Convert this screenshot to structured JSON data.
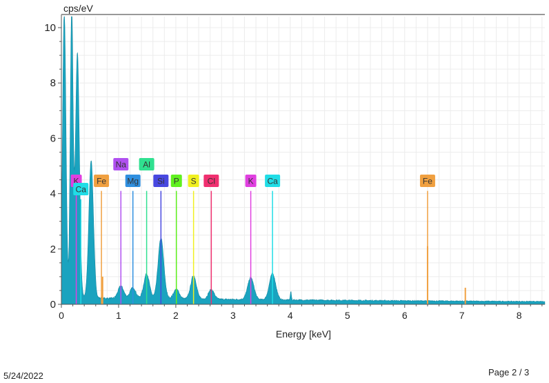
{
  "chart_data": {
    "type": "area",
    "title": "",
    "xlabel": "Energy [keV]",
    "ylabel": "cps/eV",
    "xlim": [
      0,
      8.45
    ],
    "ylim": [
      0,
      10.4
    ],
    "xticks": [
      "0",
      "1",
      "2",
      "3",
      "4",
      "5",
      "6",
      "7",
      "8"
    ],
    "yticks": [
      "0",
      "2",
      "4",
      "6",
      "8",
      "10"
    ],
    "grid": true,
    "fill_color": "#1aa3bf",
    "background_level": [
      [
        0.7,
        0.22
      ],
      [
        2.0,
        0.2
      ],
      [
        4.0,
        0.16
      ],
      [
        6.0,
        0.13
      ],
      [
        8.45,
        0.1
      ]
    ],
    "peaks": [
      {
        "x": 0.05,
        "y": 10.4,
        "w": 0.03
      },
      {
        "x": 0.18,
        "y": 10.4,
        "w": 0.025
      },
      {
        "x": 0.28,
        "y": 8.9,
        "w": 0.035
      },
      {
        "x": 0.52,
        "y": 5.0,
        "w": 0.04
      },
      {
        "x": 1.04,
        "y": 0.45,
        "w": 0.05
      },
      {
        "x": 1.25,
        "y": 0.4,
        "w": 0.05
      },
      {
        "x": 1.49,
        "y": 0.9,
        "w": 0.05
      },
      {
        "x": 1.74,
        "y": 2.2,
        "w": 0.05
      },
      {
        "x": 2.01,
        "y": 0.35,
        "w": 0.05
      },
      {
        "x": 2.31,
        "y": 0.85,
        "w": 0.05
      },
      {
        "x": 2.62,
        "y": 0.35,
        "w": 0.05
      },
      {
        "x": 3.31,
        "y": 0.8,
        "w": 0.055
      },
      {
        "x": 3.69,
        "y": 0.95,
        "w": 0.055
      },
      {
        "x": 4.01,
        "y": 0.3,
        "w": 0.01
      }
    ],
    "element_markers": [
      {
        "label": "K",
        "x": 0.26,
        "row": 1,
        "color": "#e040e0",
        "line_top": 4.1
      },
      {
        "label": "Ca",
        "x": 0.34,
        "row": 2,
        "color": "#20dde6",
        "line_top": 3.8
      },
      {
        "label": "Fe",
        "x": 0.7,
        "row": 1,
        "color": "#f0a040",
        "line_top": 4.1
      },
      {
        "label": "Na",
        "x": 1.04,
        "row": 0,
        "color": "#b050f0",
        "line_top": 4.1
      },
      {
        "label": "Mg",
        "x": 1.25,
        "row": 1,
        "color": "#3090e0",
        "line_top": 4.1
      },
      {
        "label": "Al",
        "x": 1.49,
        "row": 0,
        "color": "#30e090",
        "line_top": 4.1
      },
      {
        "label": "Si",
        "x": 1.74,
        "row": 1,
        "color": "#4848e0",
        "line_top": 4.1
      },
      {
        "label": "P",
        "x": 2.01,
        "row": 1,
        "color": "#60f020",
        "line_top": 4.1
      },
      {
        "label": "S",
        "x": 2.31,
        "row": 1,
        "color": "#f0f020",
        "line_top": 4.1
      },
      {
        "label": "Cl",
        "x": 2.62,
        "row": 1,
        "color": "#f03070",
        "line_top": 4.1
      },
      {
        "label": "K",
        "x": 3.31,
        "row": 1,
        "color": "#e040e0",
        "line_top": 4.1
      },
      {
        "label": "Ca",
        "x": 3.69,
        "row": 1,
        "color": "#20dde6",
        "line_top": 4.1
      },
      {
        "label": "Fe",
        "x": 6.4,
        "row": 1,
        "color": "#f0a040",
        "line_top": 4.1
      }
    ],
    "fe_lines": [
      {
        "x": 6.4,
        "y": 2.1
      },
      {
        "x": 7.06,
        "y": 0.6
      },
      {
        "x": 0.72,
        "y": 1.0
      }
    ]
  },
  "footer": {
    "date": "5/24/2022",
    "page": "Page 2 / 3"
  }
}
